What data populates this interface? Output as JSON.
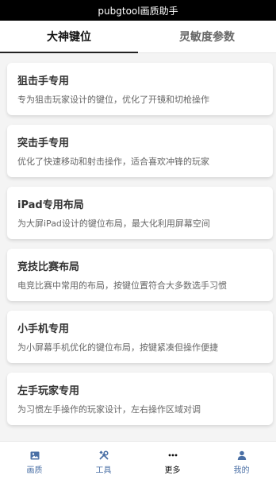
{
  "statusbar": {
    "title": "pubgtool画质助手"
  },
  "tabs": [
    {
      "label": "大神键位",
      "active": true
    },
    {
      "label": "灵敏度参数",
      "active": false
    }
  ],
  "cards": [
    {
      "title": "狙击手专用",
      "desc": "专为狙击玩家设计的键位，优化了开镜和切枪操作"
    },
    {
      "title": "突击手专用",
      "desc": "优化了快速移动和射击操作，适合喜欢冲锋的玩家"
    },
    {
      "title": "iPad专用布局",
      "desc": "为大屏iPad设计的键位布局，最大化利用屏幕空间"
    },
    {
      "title": "竞技比赛布局",
      "desc": "电竞比赛中常用的布局，按键位置符合大多数选手习惯"
    },
    {
      "title": "小手机专用",
      "desc": "为小屏幕手机优化的键位布局，按键紧凑但操作便捷"
    },
    {
      "title": "左手玩家专用",
      "desc": "为习惯左手操作的玩家设计，左右操作区域对调"
    }
  ],
  "nav": [
    {
      "label": "画质",
      "icon": "image-icon",
      "active": false
    },
    {
      "label": "工具",
      "icon": "tools-icon",
      "active": false
    },
    {
      "label": "更多",
      "icon": "more-icon",
      "active": true
    },
    {
      "label": "我的",
      "icon": "user-icon",
      "active": false
    }
  ],
  "colors": {
    "nav_inactive": "#4a6fa5",
    "nav_active": "#111111"
  }
}
